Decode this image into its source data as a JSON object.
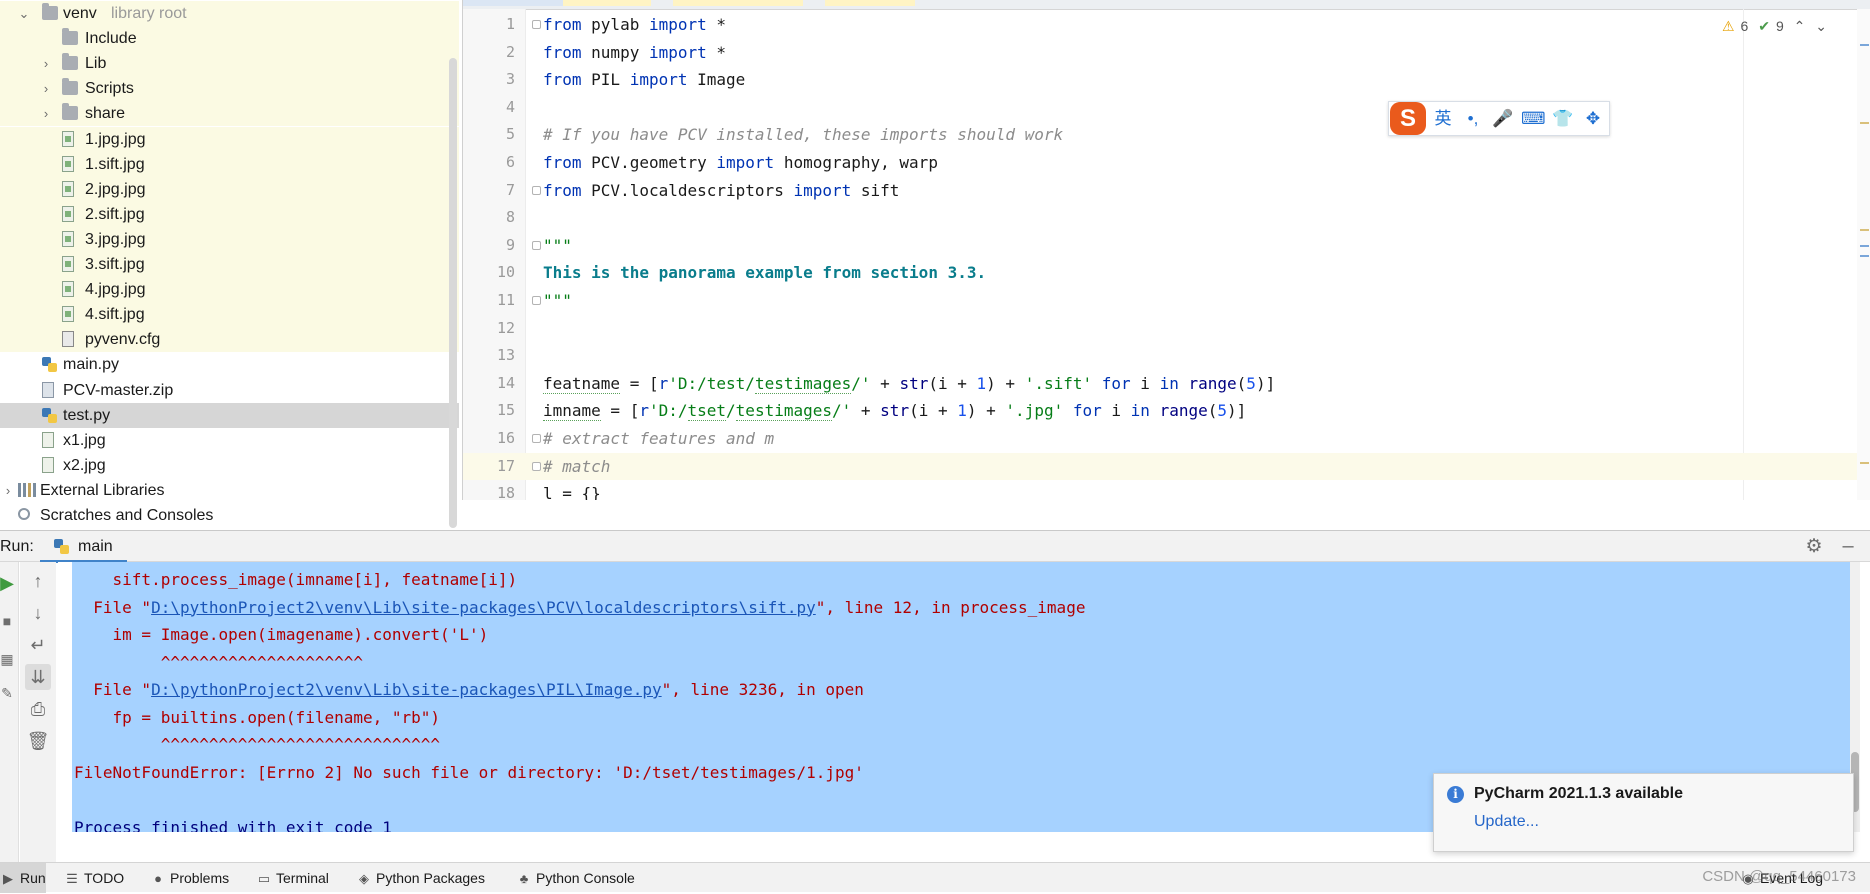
{
  "project_tree": {
    "items": [
      {
        "label": "venv",
        "hint": "library root",
        "type": "folder",
        "arrow": "down",
        "indent": 1,
        "excluded": true
      },
      {
        "label": "Include",
        "type": "folder",
        "arrow": "",
        "indent": 2,
        "excluded": true
      },
      {
        "label": "Lib",
        "type": "folder",
        "arrow": "right",
        "indent": 2,
        "excluded": true
      },
      {
        "label": "Scripts",
        "type": "folder",
        "arrow": "right",
        "indent": 2,
        "excluded": true
      },
      {
        "label": "share",
        "type": "folder",
        "arrow": "right",
        "indent": 2,
        "excluded": true
      },
      {
        "label": "1.jpg.jpg",
        "type": "file",
        "indent": 2,
        "excluded": true
      },
      {
        "label": "1.sift.jpg",
        "type": "file",
        "indent": 2,
        "excluded": true
      },
      {
        "label": "2.jpg.jpg",
        "type": "file",
        "indent": 2,
        "excluded": true
      },
      {
        "label": "2.sift.jpg",
        "type": "file",
        "indent": 2,
        "excluded": true
      },
      {
        "label": "3.jpg.jpg",
        "type": "file",
        "indent": 2,
        "excluded": true
      },
      {
        "label": "3.sift.jpg",
        "type": "file",
        "indent": 2,
        "excluded": true
      },
      {
        "label": "4.jpg.jpg",
        "type": "file",
        "indent": 2,
        "excluded": true
      },
      {
        "label": "4.sift.jpg",
        "type": "file",
        "indent": 2,
        "excluded": true
      },
      {
        "label": "pyvenv.cfg",
        "type": "cfg",
        "indent": 2,
        "excluded": true
      },
      {
        "label": "main.py",
        "type": "py",
        "indent": 1
      },
      {
        "label": "PCV-master.zip",
        "type": "zip",
        "indent": 1
      },
      {
        "label": "test.py",
        "type": "py",
        "indent": 1,
        "selected": true
      },
      {
        "label": "x1.jpg",
        "type": "img",
        "indent": 1
      },
      {
        "label": "x2.jpg",
        "type": "img",
        "indent": 1
      },
      {
        "label": "External Libraries",
        "type": "lib",
        "arrow": "right",
        "indent": 0
      },
      {
        "label": "Scratches and Consoles",
        "type": "scratch",
        "indent": 0
      }
    ]
  },
  "editor": {
    "inspections": {
      "warnings": "6",
      "weak_warnings": "9"
    },
    "lines": [
      {
        "n": "1",
        "fold": true,
        "html": "<span class=\"kw\">from</span> pylab <span class=\"kw\">import</span> *"
      },
      {
        "n": "2",
        "html": "<span class=\"kw\">from</span> numpy <span class=\"kw\">import</span> *"
      },
      {
        "n": "3",
        "html": "<span class=\"kw\">from</span> PIL <span class=\"kw\">import</span> Image"
      },
      {
        "n": "4",
        "html": ""
      },
      {
        "n": "5",
        "html": "<span class=\"cm\"># If you have PCV installed, these imports should work</span>"
      },
      {
        "n": "6",
        "html": "<span class=\"kw\">from</span> PCV.geometry <span class=\"kw\">import</span> homography, warp"
      },
      {
        "n": "7",
        "fold": true,
        "html": "<span class=\"kw\">from</span> PCV.localdescriptors <span class=\"kw\">import</span> sift"
      },
      {
        "n": "8",
        "html": ""
      },
      {
        "n": "9",
        "fold": true,
        "html": "<span class=\"doc\">\"\"\"</span>"
      },
      {
        "n": "10",
        "html": "<span class=\"docb\">This is the panorama example from section 3.3.</span>"
      },
      {
        "n": "11",
        "fold": true,
        "html": "<span class=\"doc\">\"\"\"</span>"
      },
      {
        "n": "12",
        "html": ""
      },
      {
        "n": "13",
        "html": ""
      },
      {
        "n": "14",
        "html": "<span class=\"wavy\">featname</span> = [<span class=\"kw\">r</span><span class=\"str\">'D:/test/<span class=\"wavy\">testimages</span>/'</span> + <span class=\"bi\">str</span>(i + <span class=\"num\">1</span>) + <span class=\"str\">'.sift'</span> <span class=\"kw\">for</span> i <span class=\"kw\">in</span> <span class=\"bi\">range</span>(<span class=\"num\">5</span>)]"
      },
      {
        "n": "15",
        "html": "<span class=\"wavy\">imname</span> = [<span class=\"kw\">r</span><span class=\"str\">'D:/<span class=\"wavy\">tset</span>/<span class=\"wavy\">testimages</span>/'</span> + <span class=\"bi\">str</span>(i + <span class=\"num\">1</span>) + <span class=\"str\">'.jpg'</span> <span class=\"kw\">for</span> i <span class=\"kw\">in</span> <span class=\"bi\">range</span>(<span class=\"num\">5</span>)]"
      },
      {
        "n": "16",
        "fold": true,
        "html": "<span class=\"cm\"># extract features and m</span>"
      },
      {
        "n": "17",
        "fold": true,
        "current": true,
        "html": "<span class=\"cm\"># match</span>"
      },
      {
        "n": "18",
        "html": "l = {}"
      }
    ]
  },
  "ime_bar": {
    "logo": "S",
    "items": [
      "英",
      "•,",
      "🎤",
      "⌨",
      "👕",
      "✥"
    ]
  },
  "run_window": {
    "run_label": "Run:",
    "tab_label": "main",
    "console_lines": [
      {
        "html": "    sift.process_image(imname[i], featname[i])"
      },
      {
        "html": "  File \"<span class=\"lnk\">D:\\pythonProject2\\venv\\Lib\\site-packages\\PCV\\localdescriptors\\sift.py</span>\", line 12, in process_image"
      },
      {
        "html": "    im = Image.open(imagename).convert('L')"
      },
      {
        "html": "         ^^^^^^^^^^^^^^^^^^^^^"
      },
      {
        "html": "  File \"<span class=\"lnk\">D:\\pythonProject2\\venv\\Lib\\site-packages\\PIL\\Image.py</span>\", line 3236, in open"
      },
      {
        "html": "    fp = builtins.open(filename, \"rb\")"
      },
      {
        "html": "         ^^^^^^^^^^^^^^^^^^^^^^^^^^^^^"
      },
      {
        "html": "FileNotFoundError: [Errno 2] No such file or directory: 'D:/tset/testimages/1.jpg'"
      },
      {
        "html": ""
      },
      {
        "html": "Process finished with exit code 1",
        "exit": true
      }
    ]
  },
  "notification": {
    "title": "PyCharm 2021.1.3 available",
    "link": "Update..."
  },
  "bottom_bar": {
    "items": [
      {
        "label": "Run",
        "icon": "▶",
        "active": true
      },
      {
        "label": "TODO",
        "icon": "☰"
      },
      {
        "label": "Problems",
        "icon": "●"
      },
      {
        "label": "Terminal",
        "icon": "▭"
      },
      {
        "label": "Python Packages",
        "icon": "◈"
      },
      {
        "label": "Python Console",
        "icon": "♣"
      }
    ],
    "event_log": "Event Log"
  },
  "watermark": "CSDN @qq_54460173",
  "colors": {
    "accent": "#4083c9",
    "selection": "#a6d2ff",
    "excluded_bg": "#fbfae3",
    "error_text": "#b00000"
  }
}
